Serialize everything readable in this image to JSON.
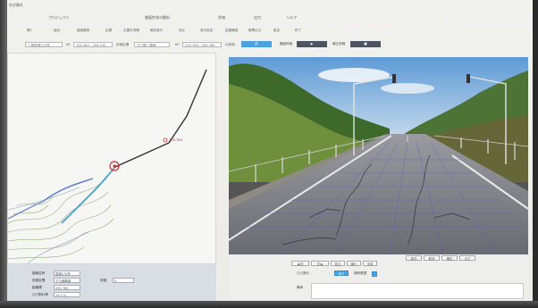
{
  "window": {
    "title": "ひび割れ"
  },
  "menu": {
    "items": [
      {
        "label": "プロジェクト"
      },
      {
        "label": "路面性状の解析"
      },
      {
        "label": "評価"
      },
      {
        "label": "出力"
      },
      {
        "label": "ヘルプ"
      }
    ]
  },
  "toolbar": {
    "items": [
      {
        "label": "開く"
      },
      {
        "label": "保存"
      },
      {
        "label": "路線選択"
      },
      {
        "label": "区間"
      },
      {
        "label": "位置を同期"
      },
      {
        "label": "解析実行"
      },
      {
        "label": "停止"
      },
      {
        "label": "表示設定"
      },
      {
        "label": "結果確認"
      },
      {
        "label": "帳票出力"
      },
      {
        "label": "設定"
      },
      {
        "label": "終了"
      }
    ]
  },
  "filters": {
    "route": "一般国道274号",
    "km_label": "KP",
    "km_value": "255.480 - 256.150",
    "section_label": "評価区間",
    "section_value": "下り線 / 車線",
    "kp_label": "KP",
    "kp_value": "255.760 - 255.760",
    "eval_label": "AI評価",
    "buttons": [
      {
        "label": "前",
        "active": true
      },
      {
        "label": "路面評価"
      },
      {
        "label": "▶"
      },
      {
        "label": "補正評価"
      },
      {
        "label": "■"
      }
    ]
  },
  "map": {
    "marker_label": "255.760"
  },
  "info": {
    "fields": [
      {
        "label": "路線名称",
        "value": "国道274号"
      },
      {
        "label": "評価区間",
        "value": "下り線車線"
      },
      {
        "label": "距離標",
        "value": "255.760"
      },
      {
        "label": "ひび割れ率",
        "value": "15.3 %"
      }
    ],
    "extra_label": "評価",
    "extra_value": "A"
  },
  "controls": {
    "buttons": [
      {
        "label": "◀ 前"
      },
      {
        "label": "次 ▶"
      },
      {
        "label": "拡大"
      },
      {
        "label": "縮小"
      },
      {
        "label": "全体"
      },
      {
        "label": "保存"
      },
      {
        "label": "取消"
      },
      {
        "label": "確定"
      },
      {
        "label": "出力"
      }
    ],
    "crack_label": "ひび割れ",
    "crack_value": "あり",
    "check_label": "補修履歴",
    "note_label": "備考",
    "note_value": ""
  }
}
